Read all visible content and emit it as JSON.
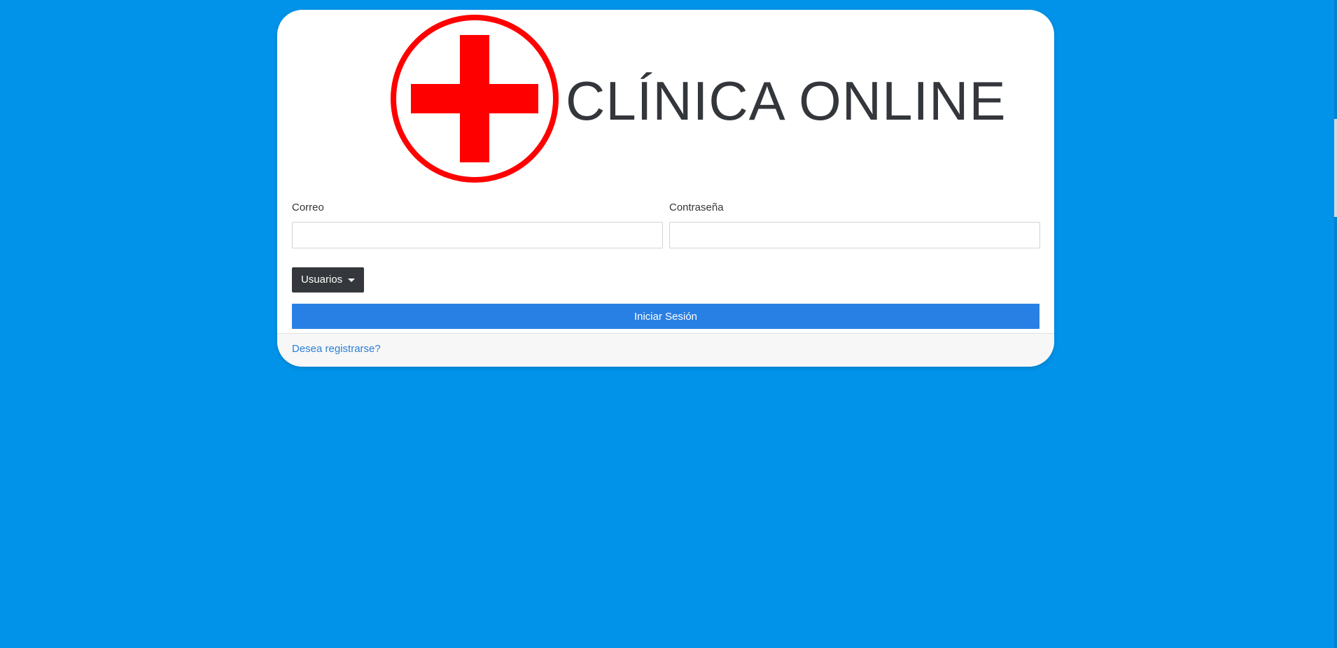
{
  "brand": {
    "title": "CLÍNICA ONLINE",
    "logo_icon": "red-cross-icon",
    "logo_color": "#ff0000"
  },
  "form": {
    "email_label": "Correo",
    "email_value": "",
    "password_label": "Contraseña",
    "password_value": "",
    "users_dropdown_label": "Usuarios",
    "submit_label": "Iniciar Sesión"
  },
  "footer": {
    "register_link": "Desea registrarse?"
  },
  "colors": {
    "background": "#0093e9",
    "primary_button": "#2980e4",
    "dark_button": "#34373b",
    "link": "#2a7fd4"
  }
}
